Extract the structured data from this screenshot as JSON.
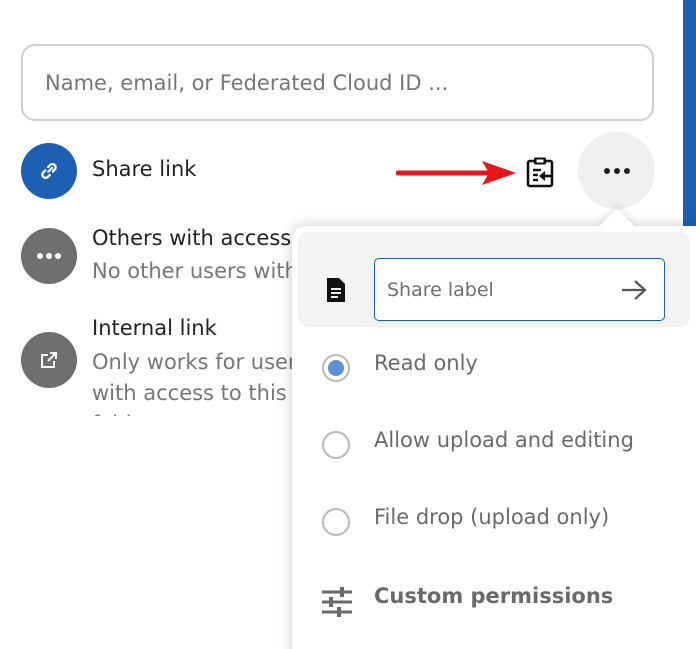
{
  "search": {
    "placeholder": "Name, email, or Federated Cloud ID ..."
  },
  "shares": [
    {
      "title": "Share link",
      "icon": "link-icon"
    },
    {
      "title": "Others with access",
      "subtitle": "No other users with access found",
      "icon": "more-horizontal-icon"
    },
    {
      "title": "Internal link",
      "subtitle": "Only works for users with access to this folder",
      "icon": "open-external-icon"
    }
  ],
  "actions": {
    "copy_icon": "clipboard-arrow-icon",
    "more_icon": "dots-horizontal-icon"
  },
  "menu": {
    "label_placeholder": "Share label",
    "options": [
      {
        "label": "Read only",
        "checked": true
      },
      {
        "label": "Allow upload and editing",
        "checked": false
      },
      {
        "label": "File drop (upload only)",
        "checked": false
      }
    ],
    "custom_permissions": "Custom permissions"
  },
  "colors": {
    "accent": "#1d5fb2",
    "annotation_arrow": "#e8151b"
  }
}
